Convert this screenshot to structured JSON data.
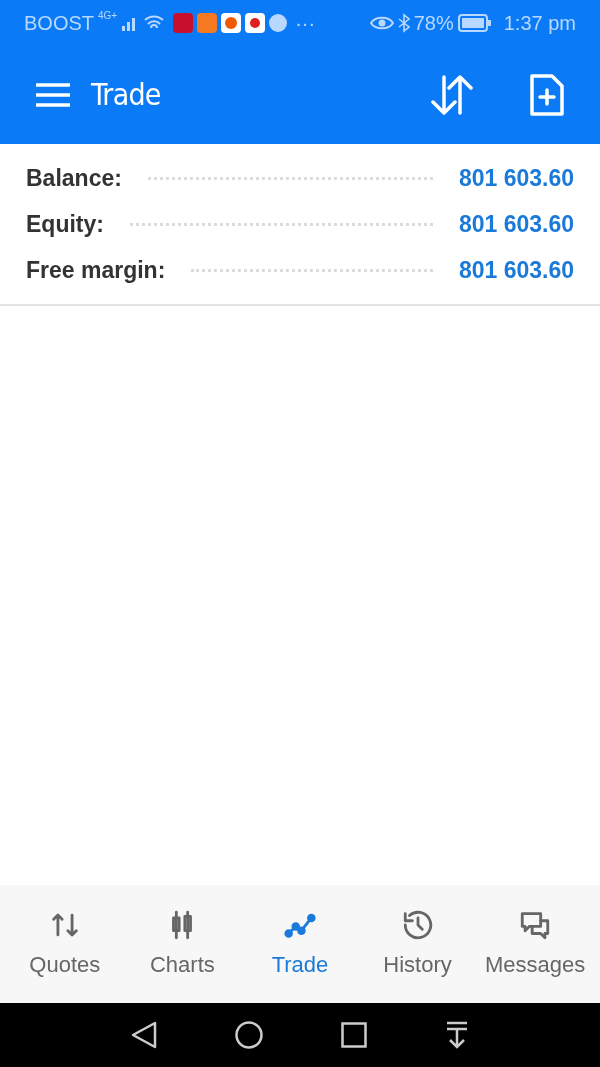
{
  "status_bar": {
    "carrier": "BOOST",
    "network": "4G+",
    "more": "···",
    "battery": "78%",
    "time": "1:37 pm"
  },
  "app_bar": {
    "title": "Trade"
  },
  "summary": [
    {
      "label": "Balance:",
      "value": "801 603.60"
    },
    {
      "label": "Equity:",
      "value": "801 603.60"
    },
    {
      "label": "Free margin:",
      "value": "801 603.60"
    }
  ],
  "bottom_nav": [
    {
      "kind": "quotes",
      "label": "Quotes",
      "selected": false
    },
    {
      "kind": "charts",
      "label": "Charts",
      "selected": false
    },
    {
      "kind": "trade",
      "label": "Trade",
      "selected": true
    },
    {
      "kind": "history",
      "label": "History",
      "selected": false
    },
    {
      "kind": "messages",
      "label": "Messages",
      "selected": false
    }
  ]
}
